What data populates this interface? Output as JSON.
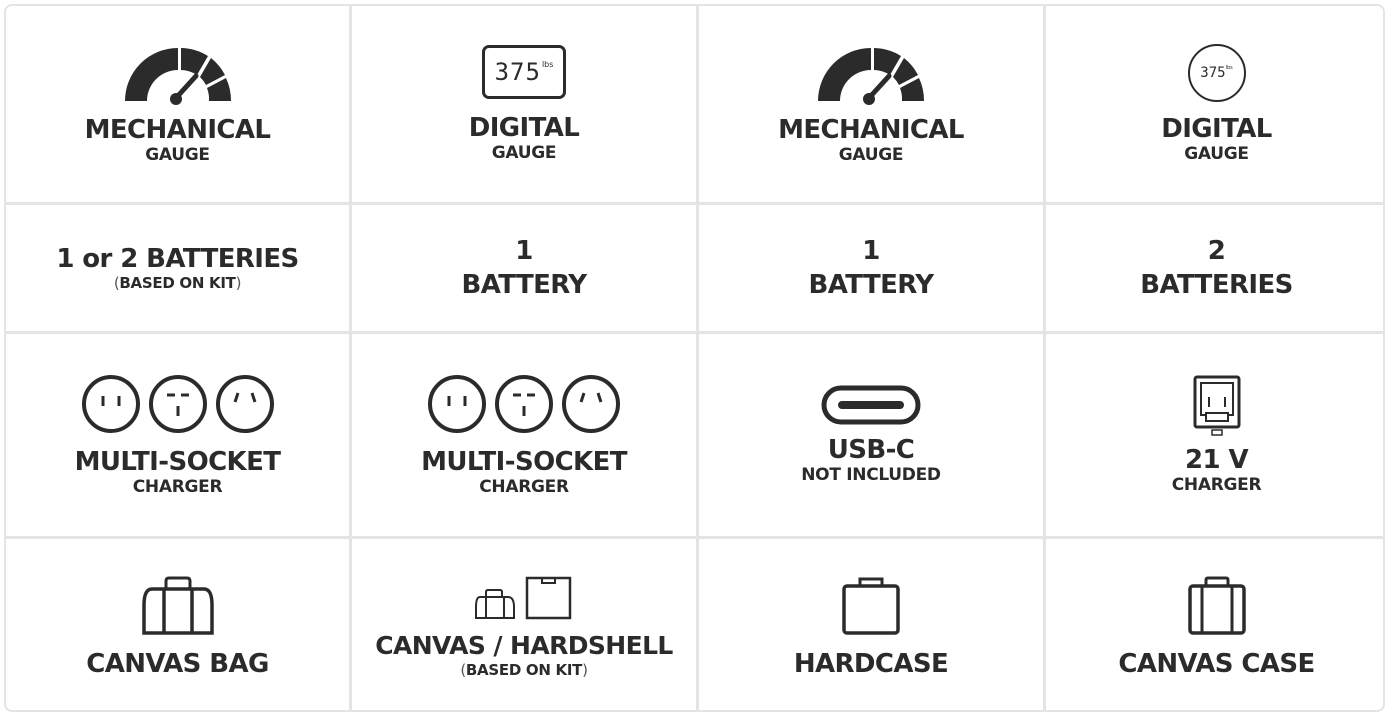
{
  "rows": [
    {
      "cells": [
        {
          "icon": "mechanical-gauge-icon",
          "title": "MECHANICAL",
          "sub": "GAUGE"
        },
        {
          "icon": "digital-display-icon",
          "display_value": "375",
          "display_unit": "lbs",
          "title": "DIGITAL",
          "sub": "GAUGE"
        },
        {
          "icon": "mechanical-gauge-icon",
          "title": "MECHANICAL",
          "sub": "GAUGE"
        },
        {
          "icon": "round-digital-display-icon",
          "display_value": "375",
          "display_unit": "lbs",
          "title": "DIGITAL",
          "sub": "GAUGE"
        }
      ]
    },
    {
      "cells": [
        {
          "title": "1 or 2 BATTERIES",
          "sub": "BASED ON KIT"
        },
        {
          "line1": "1",
          "line2": "BATTERY"
        },
        {
          "line1": "1",
          "line2": "BATTERY"
        },
        {
          "line1": "2",
          "line2": "BATTERIES"
        }
      ]
    },
    {
      "cells": [
        {
          "icon": "three-sockets-icon",
          "title": "MULTI-SOCKET",
          "sub": "CHARGER"
        },
        {
          "icon": "three-sockets-icon",
          "title": "MULTI-SOCKET",
          "sub": "CHARGER"
        },
        {
          "icon": "usb-c-port-icon",
          "title": "USB-C",
          "sub": "NOT INCLUDED"
        },
        {
          "icon": "charger-dock-icon",
          "title": "21 V",
          "sub": "CHARGER"
        }
      ]
    },
    {
      "cells": [
        {
          "icon": "canvas-bag-icon",
          "title": "CANVAS BAG"
        },
        {
          "icon": "bag-and-hardshell-icon",
          "title": "CANVAS / HARDSHELL",
          "sub": "BASED ON KIT"
        },
        {
          "icon": "hardcase-icon",
          "title": "HARDCASE"
        },
        {
          "icon": "canvas-case-icon",
          "title": "CANVAS CASE"
        }
      ]
    }
  ]
}
